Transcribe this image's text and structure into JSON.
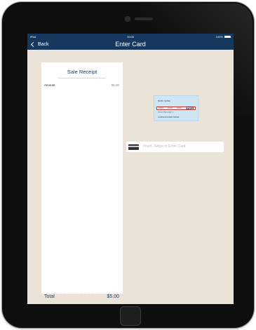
{
  "status_bar": {
    "device": "iPad",
    "time": "10:00",
    "battery_text": "100%"
  },
  "nav": {
    "back_label": "Back",
    "title": "Enter Card"
  },
  "receipt": {
    "title": "Sale Receipt",
    "amount_label": "Amount",
    "amount_value": "$5.00",
    "total_label": "Total",
    "total_value": "$5.00"
  },
  "card_illustration": {
    "bank_name": "BANK NAME",
    "number_groups": [
      "XXXX",
      "XXXX",
      "XXXX"
    ],
    "last4": "1234",
    "expiry": "VALID THRU  MM/YY",
    "holder": "CARDHOLDER NAME"
  },
  "card_entry": {
    "placeholder": "Insert, Swipe or Enter Card",
    "icon": "credit-card-icon"
  },
  "colors": {
    "nav_bg": "#16385f",
    "screen_bg": "#ece3d8",
    "accent_text": "#1c3d66",
    "card_bg": "#cfe6f5",
    "highlight": "#c0392b"
  }
}
